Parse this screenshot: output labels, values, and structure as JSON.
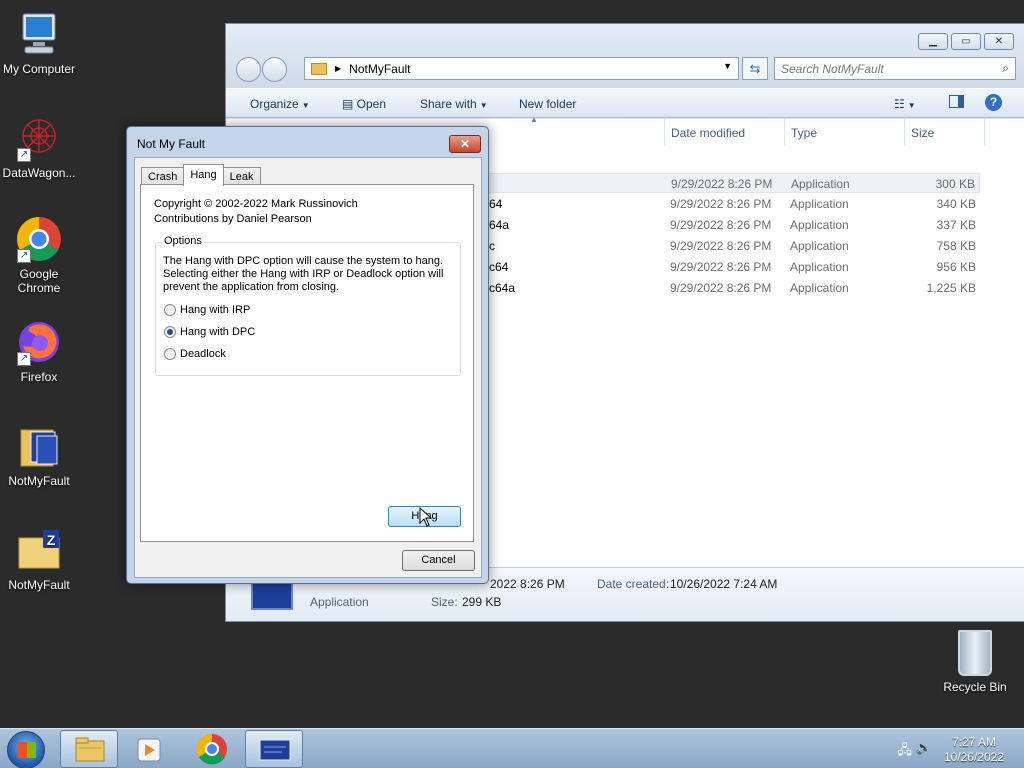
{
  "desktop": {
    "icons": [
      {
        "label": "My Computer"
      },
      {
        "label": "DataWagon..."
      },
      {
        "label": "Google Chrome"
      },
      {
        "label": "Firefox"
      },
      {
        "label": "NotMyFault"
      },
      {
        "label": "NotMyFault"
      }
    ],
    "recycle_bin": "Recycle Bin"
  },
  "explorer": {
    "address": "NotMyFault",
    "search_placeholder": "Search NotMyFault",
    "toolbar": {
      "organize": "Organize",
      "open": "Open",
      "share_with": "Share with",
      "new_folder": "New folder"
    },
    "columns": {
      "date": "Date modified",
      "type": "Type",
      "size": "Size"
    },
    "rows": [
      {
        "name": "",
        "date": "9/29/2022 8:26 PM",
        "type": "Application",
        "size": "300 KB"
      },
      {
        "name": "64",
        "date": "9/29/2022 8:26 PM",
        "type": "Application",
        "size": "340 KB"
      },
      {
        "name": "64a",
        "date": "9/29/2022 8:26 PM",
        "type": "Application",
        "size": "337 KB"
      },
      {
        "name": "c",
        "date": "9/29/2022 8:26 PM",
        "type": "Application",
        "size": "758 KB"
      },
      {
        "name": "c64",
        "date": "9/29/2022 8:26 PM",
        "type": "Application",
        "size": "956 KB"
      },
      {
        "name": "c64a",
        "date": "9/29/2022 8:26 PM",
        "type": "Application",
        "size": "1,225 KB"
      }
    ],
    "details": {
      "modified": "2022 8:26 PM",
      "created_label": "Date created:",
      "created": "10/26/2022 7:24 AM",
      "type": "Application",
      "size_label": "Size:",
      "size": "299 KB"
    }
  },
  "dialog": {
    "title": "Not My Fault",
    "tabs": [
      "Crash",
      "Hang",
      "Leak"
    ],
    "copyright_1": "Copyright © 2002-2022 Mark Russinovich",
    "copyright_2": "Contributions by Daniel Pearson",
    "options_label": "Options",
    "description": "The Hang with DPC option will cause the system to hang. Selecting either the Hang with IRP or Deadlock option will prevent the application from closing.",
    "radios": [
      {
        "label": "Hang with IRP",
        "checked": false
      },
      {
        "label": "Hang with DPC",
        "checked": true
      },
      {
        "label": "Deadlock",
        "checked": false
      }
    ],
    "hang_button": "Hang",
    "cancel_button": "Cancel"
  },
  "taskbar": {
    "time": "7:27 AM",
    "date": "10/26/2022"
  }
}
